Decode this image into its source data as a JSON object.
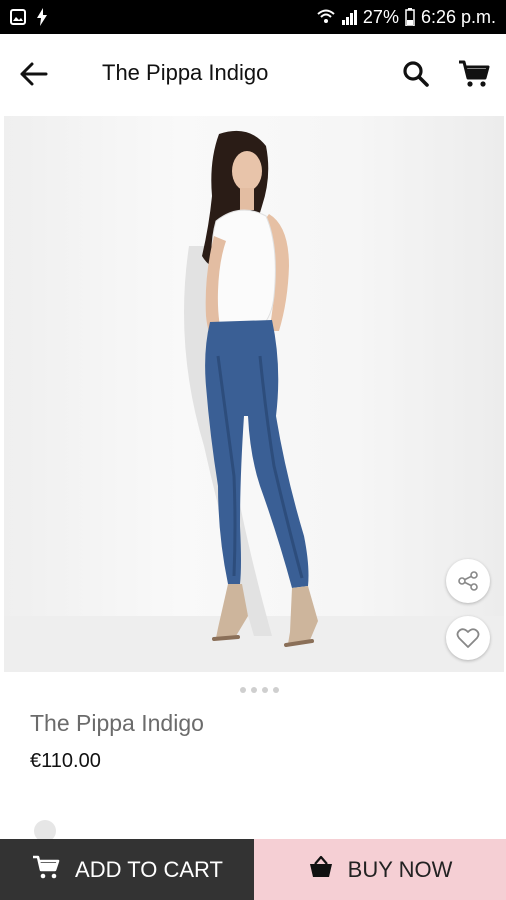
{
  "status_bar": {
    "battery": "27%",
    "time": "6:26 p.m.",
    "icons": [
      "gallery-icon",
      "flash-icon",
      "wifi-icon",
      "signal-icon",
      "battery-icon"
    ]
  },
  "app_bar": {
    "title": "The Pippa Indigo",
    "icons": [
      "back-arrow-icon",
      "search-icon",
      "cart-icon"
    ]
  },
  "product": {
    "name": "The Pippa Indigo",
    "price": "€110.00",
    "image_dots": 4,
    "actions": [
      "share-icon",
      "heart-icon"
    ]
  },
  "bottom_bar": {
    "add_to_cart": "ADD TO CART",
    "buy_now": "BUY NOW",
    "colors": {
      "add_to_cart_bg": "#333333",
      "buy_now_bg": "#f5cfd4"
    }
  }
}
